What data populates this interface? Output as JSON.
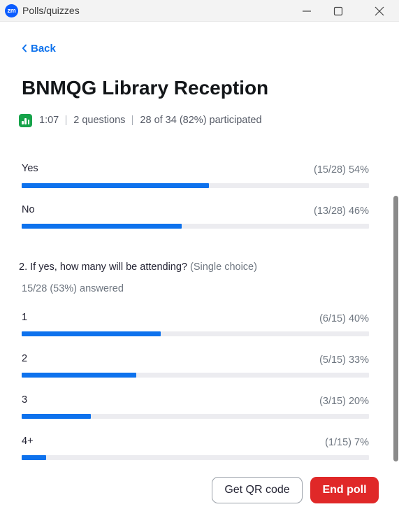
{
  "window": {
    "app_icon_text": "zm",
    "title": "Polls/quizzes"
  },
  "nav": {
    "back_label": "Back"
  },
  "poll": {
    "title": "BNMQG Library Reception",
    "duration": "1:07",
    "questions_count": "2 questions",
    "participation": "28 of 34 (82%) participated"
  },
  "question1": {
    "options": [
      {
        "label": "Yes",
        "stat": "(15/28) 54%",
        "fraction": 0.54
      },
      {
        "label": "No",
        "stat": "(13/28) 46%",
        "fraction": 0.46
      }
    ]
  },
  "question2": {
    "text": "2. If yes, how many will be attending?",
    "type": "(Single choice)",
    "answered": "15/28 (53%) answered",
    "options": [
      {
        "label": "1",
        "stat": "(6/15) 40%",
        "fraction": 0.4
      },
      {
        "label": "2",
        "stat": "(5/15) 33%",
        "fraction": 0.33
      },
      {
        "label": "3",
        "stat": "(3/15) 20%",
        "fraction": 0.2
      },
      {
        "label": "4+",
        "stat": "(1/15) 7%",
        "fraction": 0.07
      }
    ]
  },
  "footer": {
    "qr_label": "Get QR code",
    "end_label": "End poll"
  },
  "colors": {
    "accent": "#0e72ed",
    "bar_fill": "#0e72ed",
    "bar_track": "#ececf0",
    "end_button": "#e02828",
    "meta_icon": "#16a34a"
  },
  "icons": {
    "app": "zoom-logo-icon",
    "back": "chevron-left-icon",
    "meta": "bar-chart-icon"
  }
}
